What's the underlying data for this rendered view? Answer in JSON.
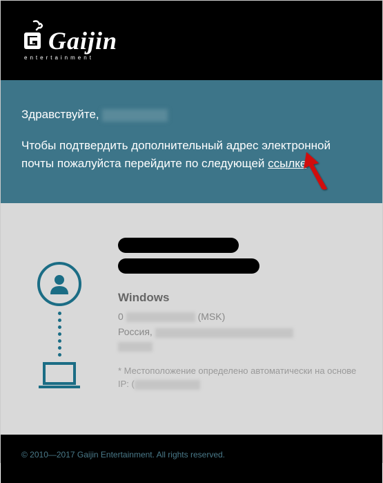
{
  "logo": {
    "text": "Gaijin",
    "subtitle": "entertainment"
  },
  "message": {
    "greeting_prefix": "Здравствуйте, ",
    "instruction_part1": "Чтобы подтвердить дополнительный адрес электронной почты пожалуйста перейдите по следующей ",
    "link_text": "ссылке"
  },
  "details": {
    "os": "Windows",
    "date_prefix": "0",
    "tz": "(MSK)",
    "country": "Россия, ",
    "disclaimer": "* Местоположение определено автоматически на основе IP: ("
  },
  "footer": {
    "copyright": "© 2010—2017 Gaijin Entertainment. All rights reserved."
  }
}
